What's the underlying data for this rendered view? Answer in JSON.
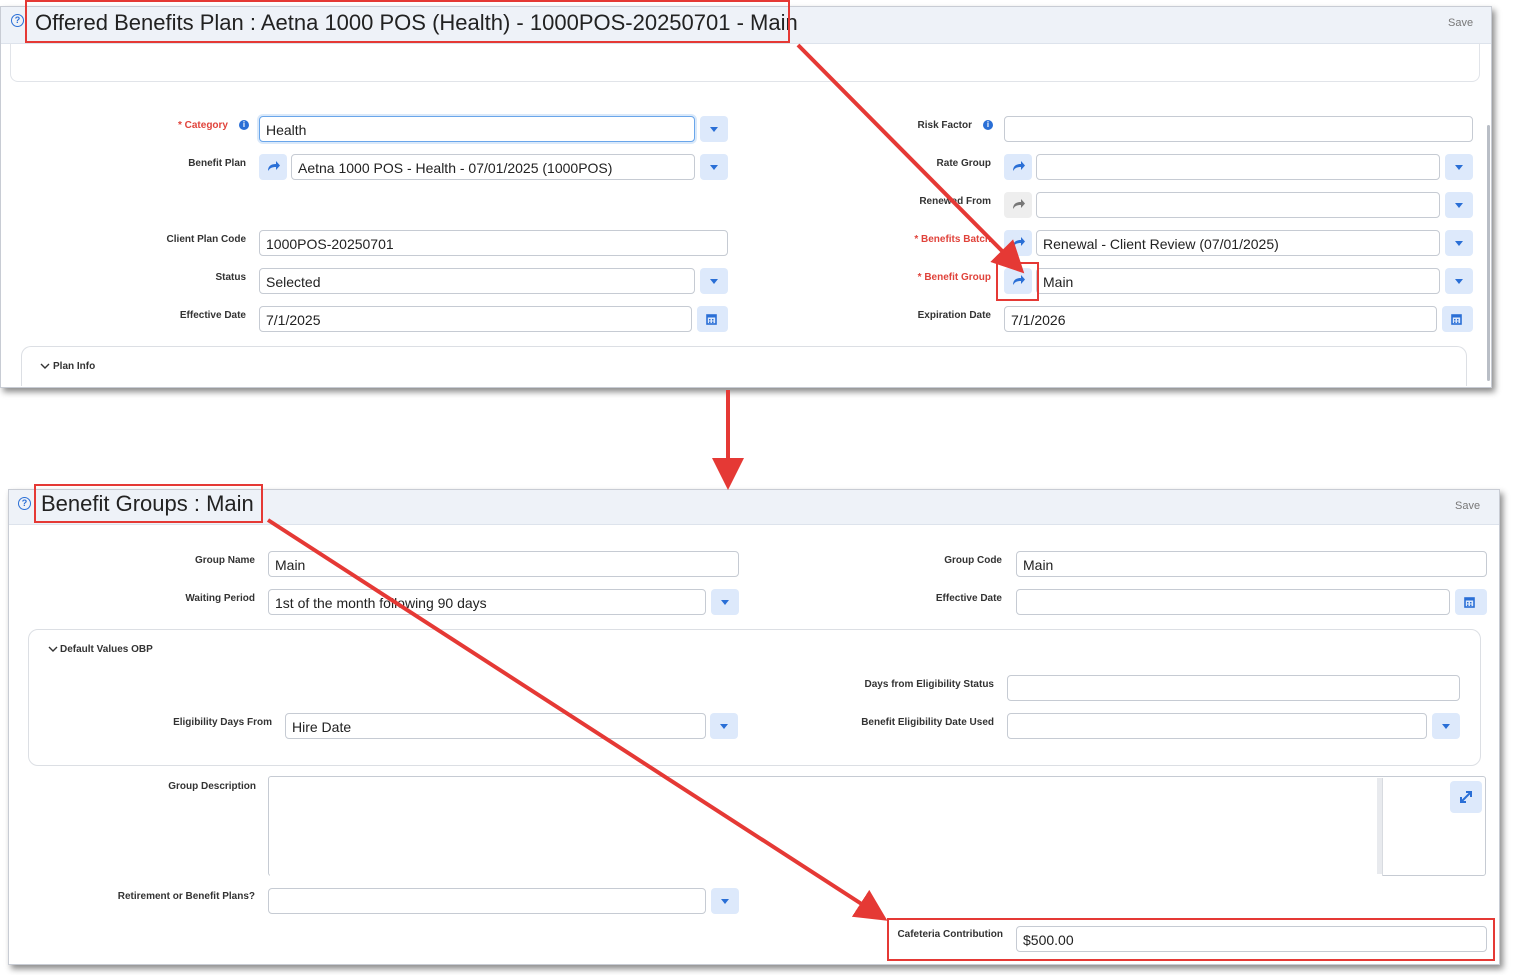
{
  "top_window": {
    "title": "Offered Benefits Plan : Aetna 1000 POS (Health) - 1000POS-20250701 - Main",
    "save_label": "Save",
    "help_glyph": "?",
    "info_glyph": "i",
    "required_mark": "* ",
    "fields": {
      "category": {
        "label": "Category",
        "value": "Health"
      },
      "benefit_plan": {
        "label": "Benefit Plan",
        "value": "Aetna 1000 POS - Health - 07/01/2025 (1000POS)"
      },
      "client_plan_code": {
        "label": "Client Plan Code",
        "value": "1000POS-20250701"
      },
      "status": {
        "label": "Status",
        "value": "Selected"
      },
      "effective_date": {
        "label": "Effective Date",
        "value": "7/1/2025"
      },
      "risk_factor": {
        "label": "Risk Factor",
        "value": ""
      },
      "rate_group": {
        "label": "Rate Group",
        "value": ""
      },
      "renewed_from": {
        "label": "Renewed From",
        "value": ""
      },
      "benefits_batch": {
        "label": "Benefits Batch",
        "value": "Renewal - Client Review (07/01/2025)"
      },
      "benefit_group": {
        "label": "Benefit Group",
        "value": "Main"
      },
      "expiration_date": {
        "label": "Expiration Date",
        "value": "7/1/2026"
      }
    },
    "plan_info_section": "Plan Info"
  },
  "bottom_window": {
    "title": "Benefit Groups : Main",
    "save_label": "Save",
    "help_glyph": "?",
    "fields": {
      "group_name": {
        "label": "Group Name",
        "value": "Main"
      },
      "group_code": {
        "label": "Group Code",
        "value": "Main"
      },
      "waiting_period": {
        "label": "Waiting Period",
        "value": "1st of the month following 90 days"
      },
      "effective_date": {
        "label": "Effective Date",
        "value": ""
      },
      "days_from_eligibility_status": {
        "label": "Days from Eligibility Status",
        "value": ""
      },
      "eligibility_days_from": {
        "label": "Eligibility Days From",
        "value": "Hire Date"
      },
      "benefit_eligibility_date_used": {
        "label": "Benefit Eligibility Date Used",
        "value": ""
      },
      "group_description": {
        "label": "Group Description",
        "value": ""
      },
      "retirement_or_benefit_plans": {
        "label": "Retirement or Benefit Plans?",
        "value": ""
      },
      "cafeteria_contribution": {
        "label": "Cafeteria Contribution",
        "value": "$500.00"
      }
    },
    "default_values_section": "Default Values OBP"
  },
  "colors": {
    "annotation_red": "#e53935",
    "accent_blue": "#2a6fd6",
    "required_red": "#e0433b",
    "button_bg": "#dde9fb"
  },
  "icons": [
    "help-icon",
    "info-icon",
    "redirect-arrow-icon",
    "calendar-icon",
    "chevron-down-icon",
    "expand-icon",
    "caret-down-icon"
  ]
}
